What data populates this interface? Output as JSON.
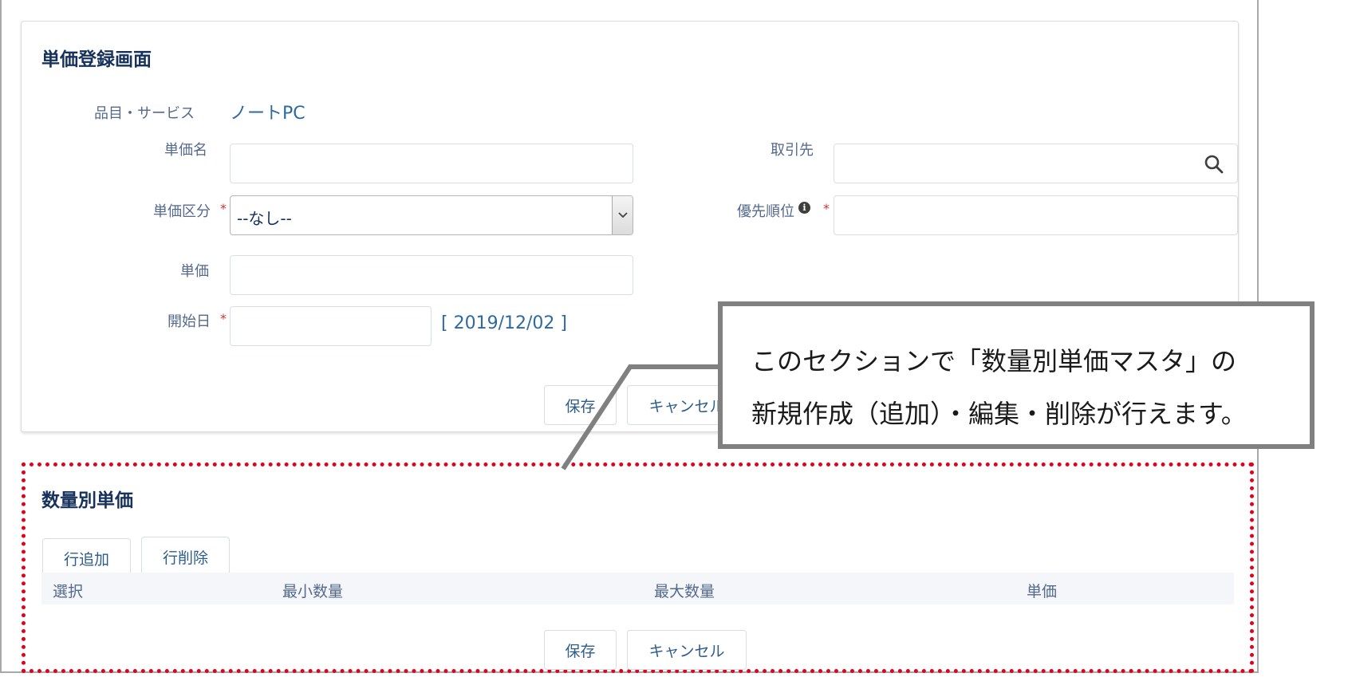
{
  "main_form": {
    "title": "単価登録画面",
    "product_label": "品目・サービス",
    "product_value": "ノートPC",
    "price_name_label": "単価名",
    "price_name_value": "",
    "partner_label": "取引先",
    "partner_value": "",
    "price_type_label": "単価区分",
    "price_type_selected": "--なし--",
    "priority_label": "優先順位",
    "priority_value": "",
    "unit_price_label": "単価",
    "unit_price_value": "",
    "start_date_label": "開始日",
    "start_date_value": "",
    "date_hint": "[ 2019/12/02 ]",
    "required_mark": "*",
    "info_glyph": "i",
    "save_label": "保存",
    "cancel_label": "キャンセル"
  },
  "quantity_section": {
    "title": "数量別単価",
    "add_row_label": "行追加",
    "delete_row_label": "行削除",
    "columns": [
      "選択",
      "最小数量",
      "最大数量",
      "単価"
    ],
    "save_label": "保存",
    "cancel_label": "キャンセル"
  },
  "callout": {
    "line1": "このセクションで「数量別単価マスタ」の",
    "line2": "新規作成（追加）・編集・削除が行えます。"
  },
  "colors": {
    "title": "#16325c",
    "label": "#54698d",
    "link": "#2e6a9e",
    "required": "#c23934",
    "highlight_border": "#e3001b",
    "callout_border": "#808080"
  },
  "icons": {
    "partner_search": "search-icon",
    "select_toggle": "chevron-down-icon",
    "priority_help": "info-icon"
  }
}
